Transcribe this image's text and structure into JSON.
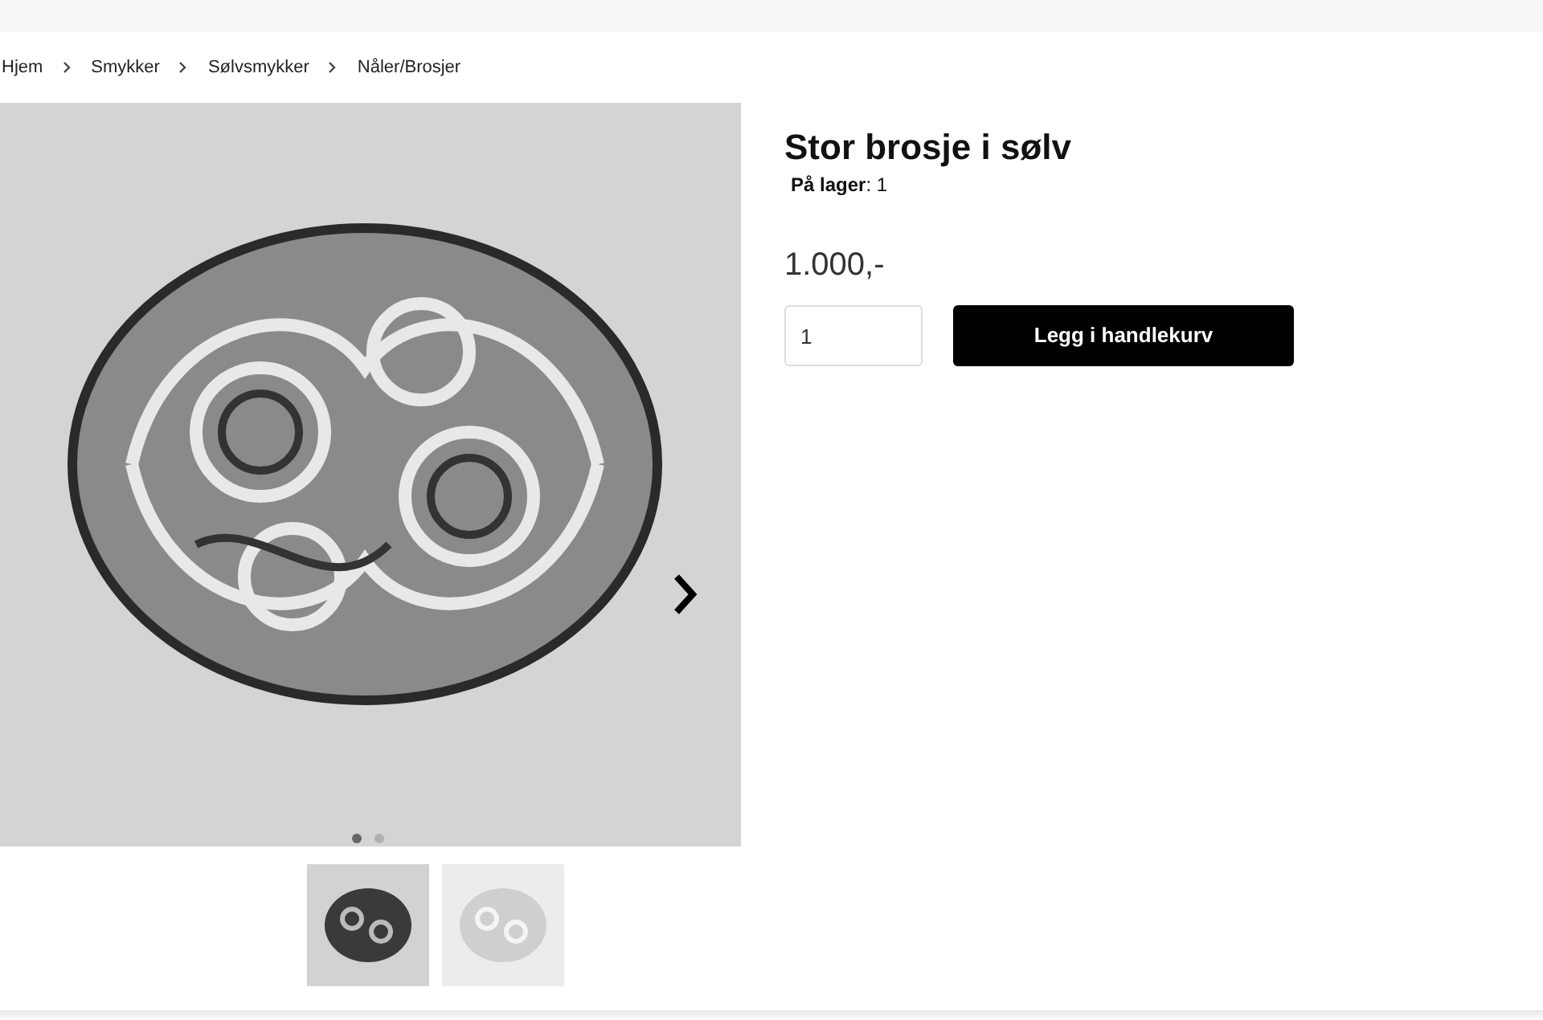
{
  "breadcrumb": [
    "Hjem",
    "Smykker",
    "Sølvsmykker",
    "Nåler/Brosjer"
  ],
  "gallery": {
    "dots": [
      {
        "selected": true
      },
      {
        "selected": false
      }
    ],
    "thumbnails": [
      {
        "kind": "dark"
      },
      {
        "kind": "light"
      }
    ]
  },
  "product": {
    "title": "Stor brosje i sølv",
    "stock": "**På lager**: 1",
    "price": "1.000,-",
    "quantity": "1",
    "add_to_cart": "Legg i handlekurv"
  }
}
